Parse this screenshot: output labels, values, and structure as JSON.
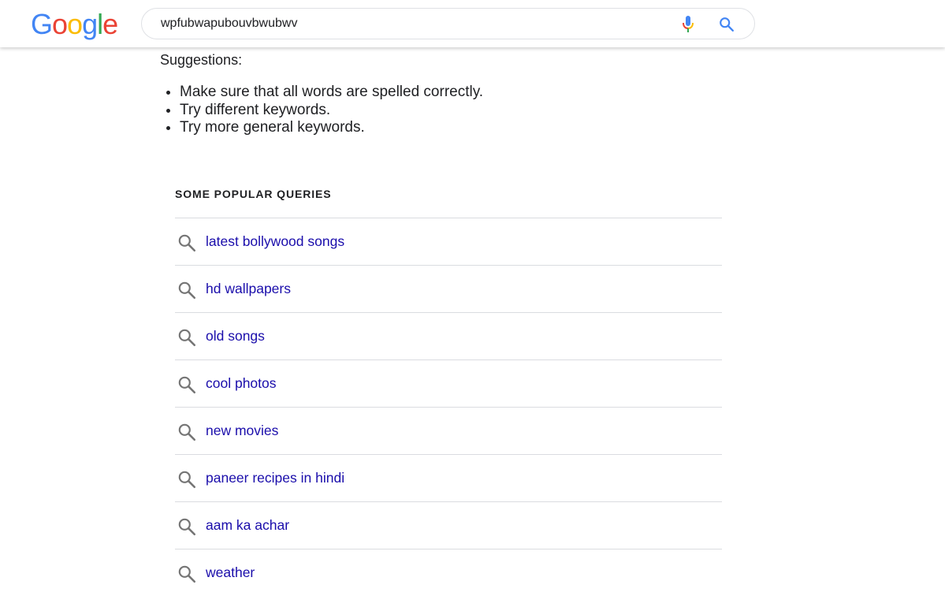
{
  "header": {
    "logo_letters": [
      {
        "char": "G",
        "color": "#4285F4"
      },
      {
        "char": "o",
        "color": "#EA4335"
      },
      {
        "char": "o",
        "color": "#FBBC05"
      },
      {
        "char": "g",
        "color": "#4285F4"
      },
      {
        "char": "l",
        "color": "#34A853"
      },
      {
        "char": "e",
        "color": "#EA4335"
      }
    ],
    "search": {
      "value": "wpfubwapubouvbwubwv",
      "mic_icon": "microphone-icon",
      "search_icon": "search-icon"
    }
  },
  "suggestions": {
    "label": "Suggestions:",
    "items": [
      "Make sure that all words are spelled correctly.",
      "Try different keywords.",
      "Try more general keywords."
    ]
  },
  "popular": {
    "heading": "SOME POPULAR QUERIES",
    "queries": [
      "latest bollywood songs",
      "hd wallpapers",
      "old songs",
      "cool photos",
      "new movies",
      "paneer recipes in hindi",
      "aam ka achar",
      "weather"
    ]
  },
  "colors": {
    "link": "#1a0dab",
    "text": "#202124",
    "divider": "#dadce0",
    "icon_gray": "#757575"
  }
}
